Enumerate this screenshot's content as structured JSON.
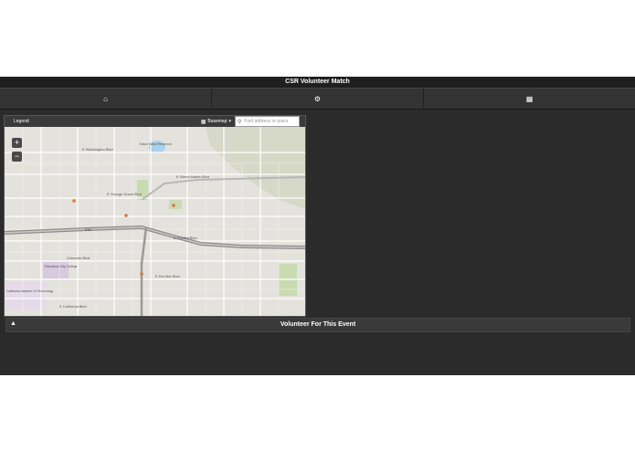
{
  "app": {
    "title": "CSR Volunteer Match"
  },
  "nav": {
    "items": [
      {
        "icon": "home-icon",
        "glyph": "⌂"
      },
      {
        "icon": "gear-icon",
        "glyph": "⚙"
      },
      {
        "icon": "grid-icon",
        "glyph": "▦"
      }
    ]
  },
  "map": {
    "legend_label": "Legend",
    "basemap_label": "Basemap",
    "search_placeholder": "Find address or place",
    "zoom_in": "+",
    "zoom_out": "−",
    "labels": {
      "washington": "E Washington Blvd",
      "orange_grove": "E Orange Grove Blvd",
      "sierra_madre": "E Sierra Madre Blvd",
      "foothill": "E Foothill Blvd",
      "colorado": "Colorado Blvd",
      "del_mar": "E Del Mar Blvd",
      "california": "E California Blvd",
      "city_college": "Pasadena City College",
      "caltech": "California Institute Of Technology",
      "eaton_wash": "Eaton Wash Reservoir",
      "hwy": "210"
    }
  },
  "volunteer": {
    "label": "Volunteer For This Event",
    "icon": "warning-icon"
  }
}
